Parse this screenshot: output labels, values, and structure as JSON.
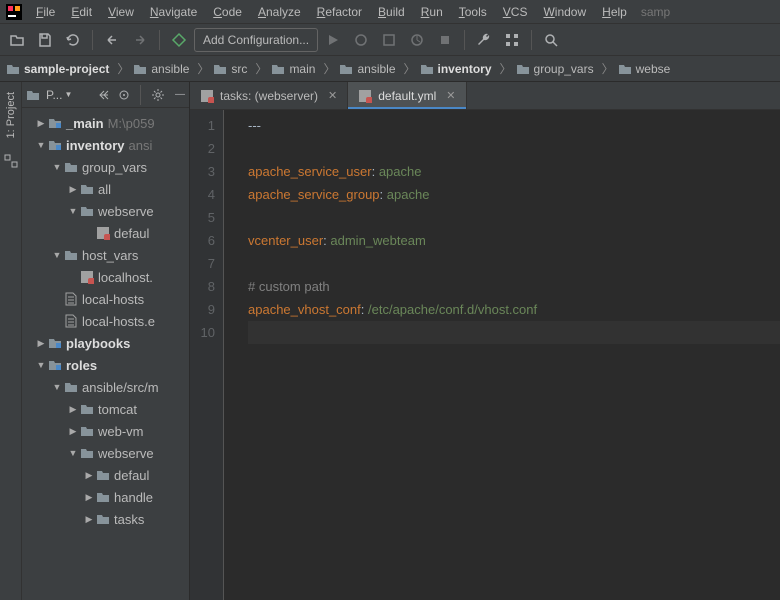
{
  "menubar": {
    "items": [
      "File",
      "Edit",
      "View",
      "Navigate",
      "Code",
      "Analyze",
      "Refactor",
      "Build",
      "Run",
      "Tools",
      "VCS",
      "Window",
      "Help"
    ],
    "tail": "samp"
  },
  "toolbar": {
    "addConfig": "Add Configuration..."
  },
  "breadcrumb": [
    {
      "label": "sample-project",
      "bold": true,
      "icon": "folder"
    },
    {
      "label": "ansible",
      "icon": "folder"
    },
    {
      "label": "src",
      "icon": "folder"
    },
    {
      "label": "main",
      "icon": "folder"
    },
    {
      "label": "ansible",
      "icon": "folder"
    },
    {
      "label": "inventory",
      "bold": true,
      "icon": "folder"
    },
    {
      "label": "group_vars",
      "icon": "folder"
    },
    {
      "label": "webse",
      "icon": "folder"
    }
  ],
  "sidebar": {
    "leftLabel": "1: Project",
    "dropdown": "P..."
  },
  "tree": [
    {
      "ind": 0,
      "arrow": "▶",
      "icon": "folder-mod",
      "label": "_main",
      "bold": true,
      "extra": "M:\\p059"
    },
    {
      "ind": 0,
      "arrow": "▼",
      "icon": "folder-mod",
      "label": "inventory",
      "bold": true,
      "extra": "ansi"
    },
    {
      "ind": 1,
      "arrow": "▼",
      "icon": "folder",
      "label": "group_vars"
    },
    {
      "ind": 2,
      "arrow": "▶",
      "icon": "folder",
      "label": "all"
    },
    {
      "ind": 2,
      "arrow": "▼",
      "icon": "folder",
      "label": "webserve"
    },
    {
      "ind": 3,
      "arrow": "",
      "icon": "yaml",
      "label": "defaul"
    },
    {
      "ind": 1,
      "arrow": "▼",
      "icon": "folder",
      "label": "host_vars"
    },
    {
      "ind": 2,
      "arrow": "",
      "icon": "yaml",
      "label": "localhost."
    },
    {
      "ind": 1,
      "arrow": "",
      "icon": "file",
      "label": "local-hosts"
    },
    {
      "ind": 1,
      "arrow": "",
      "icon": "file",
      "label": "local-hosts.e"
    },
    {
      "ind": 0,
      "arrow": "▶",
      "icon": "folder-mod",
      "label": "playbooks",
      "bold": true
    },
    {
      "ind": 0,
      "arrow": "▼",
      "icon": "folder-mod",
      "label": "roles",
      "bold": true
    },
    {
      "ind": 1,
      "arrow": "▼",
      "icon": "folder",
      "label": "ansible/src/m"
    },
    {
      "ind": 2,
      "arrow": "▶",
      "icon": "folder",
      "label": "tomcat"
    },
    {
      "ind": 2,
      "arrow": "▶",
      "icon": "folder",
      "label": "web-vm"
    },
    {
      "ind": 2,
      "arrow": "▼",
      "icon": "folder",
      "label": "webserve"
    },
    {
      "ind": 3,
      "arrow": "▶",
      "icon": "folder",
      "label": "defaul"
    },
    {
      "ind": 3,
      "arrow": "▶",
      "icon": "folder",
      "label": "handle"
    },
    {
      "ind": 3,
      "arrow": "▶",
      "icon": "folder",
      "label": "tasks"
    }
  ],
  "tabs": [
    {
      "label": "tasks: (webserver)",
      "icon": "yaml",
      "active": false
    },
    {
      "label": "default.yml",
      "icon": "yaml",
      "active": true
    }
  ],
  "code": {
    "lines": [
      {
        "n": 1,
        "t": "---",
        "c": "plain"
      },
      {
        "n": 2,
        "t": "",
        "c": "plain"
      },
      {
        "n": 3,
        "k": "apache_service_user",
        "v": "apache"
      },
      {
        "n": 4,
        "k": "apache_service_group",
        "v": "apache"
      },
      {
        "n": 5,
        "t": "",
        "c": "plain"
      },
      {
        "n": 6,
        "k": "vcenter_user",
        "v": "admin_webteam"
      },
      {
        "n": 7,
        "t": "",
        "c": "plain"
      },
      {
        "n": 8,
        "t": "# custom path",
        "c": "comment"
      },
      {
        "n": 9,
        "k": "apache_vhost_conf",
        "v": "/etc/apache/conf.d/vhost.conf"
      },
      {
        "n": 10,
        "t": "",
        "c": "plain",
        "current": true
      }
    ]
  }
}
